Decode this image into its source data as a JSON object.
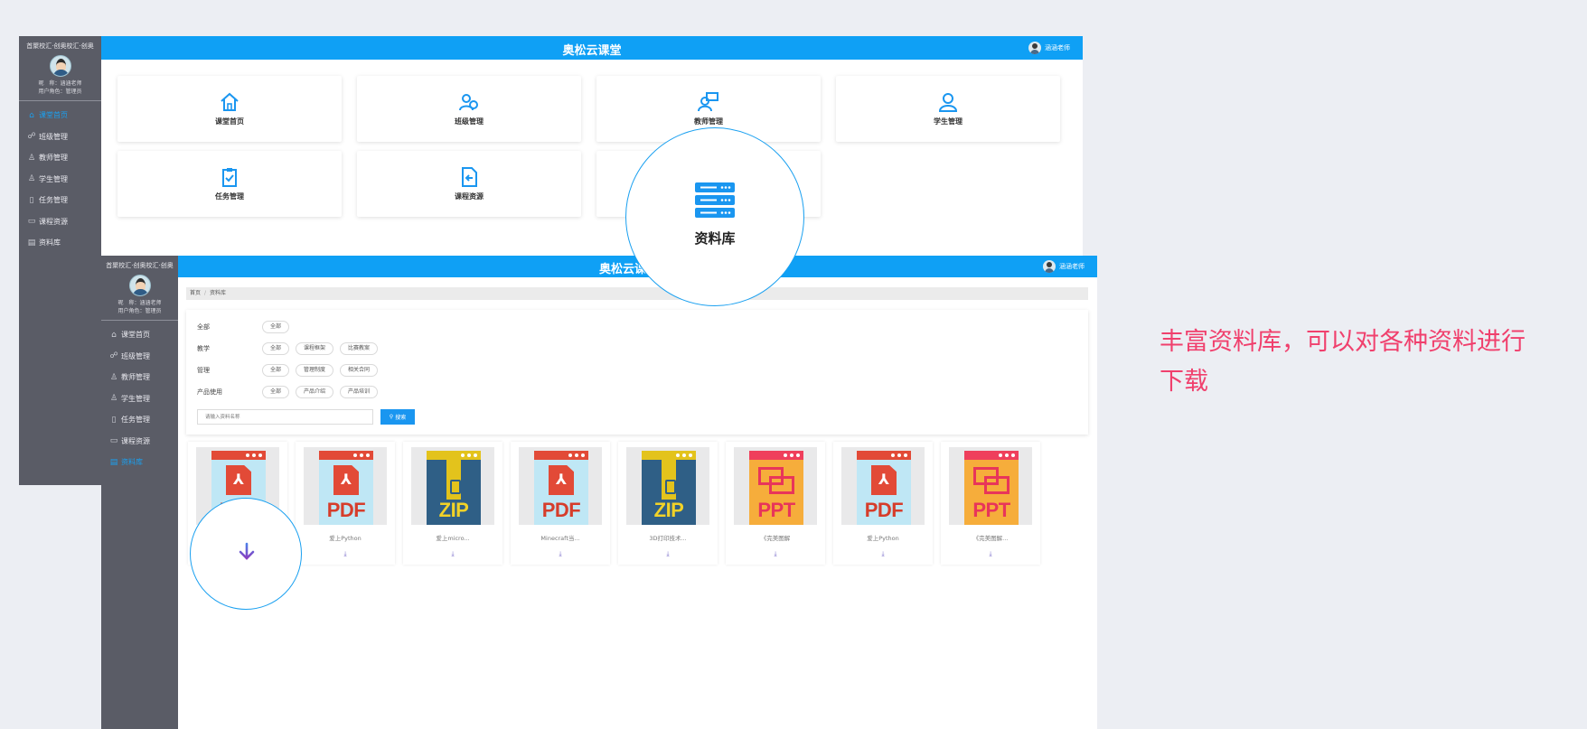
{
  "app_title": "奥松云课堂",
  "user_name": "涵涵老师",
  "sidebar": {
    "school": "首聚校汇·创奥校汇·创奥",
    "nickname": "昵　称：涵涵老师",
    "role": "用户角色：管理员",
    "items": [
      {
        "label": "课堂首页",
        "icon": "home-icon"
      },
      {
        "label": "班级管理",
        "icon": "class-icon"
      },
      {
        "label": "教师管理",
        "icon": "teacher-icon"
      },
      {
        "label": "学生管理",
        "icon": "student-icon"
      },
      {
        "label": "任务管理",
        "icon": "task-icon"
      },
      {
        "label": "课程资源",
        "icon": "course-icon"
      },
      {
        "label": "资料库",
        "icon": "library-icon"
      }
    ]
  },
  "dashboard": {
    "cards": [
      {
        "label": "课堂首页",
        "icon": "home-icon"
      },
      {
        "label": "班级管理",
        "icon": "class-icon"
      },
      {
        "label": "教师管理",
        "icon": "teacher-icon"
      },
      {
        "label": "学生管理",
        "icon": "student-icon"
      },
      {
        "label": "任务管理",
        "icon": "clipboard-icon"
      },
      {
        "label": "课程资源",
        "icon": "resource-icon"
      }
    ]
  },
  "library": {
    "breadcrumb": [
      "首页",
      "资料库"
    ],
    "filters": [
      {
        "label": "全部",
        "chips": [
          "全部"
        ]
      },
      {
        "label": "教学",
        "chips": [
          "全部",
          "课程框架",
          "比赛教案"
        ]
      },
      {
        "label": "管理",
        "chips": [
          "全部",
          "管理制度",
          "相关合同"
        ]
      },
      {
        "label": "产品使用",
        "chips": [
          "全部",
          "产品介绍",
          "产品培训"
        ]
      }
    ],
    "search_placeholder": "请输入资料名称",
    "search_button": "搜索",
    "files": [
      {
        "type": "PDF",
        "name": ""
      },
      {
        "type": "PDF",
        "name": "爱上Python"
      },
      {
        "type": "ZIP",
        "name": "爱上micro..."
      },
      {
        "type": "PDF",
        "name": "Minecraft当..."
      },
      {
        "type": "ZIP",
        "name": "3D打印技术..."
      },
      {
        "type": "PPT",
        "name": "《完美图解"
      },
      {
        "type": "PDF",
        "name": "爱上Python"
      },
      {
        "type": "PPT",
        "name": "《完美图解..."
      }
    ],
    "download_glyph": "⤓"
  },
  "callout": {
    "library_label": "资料库",
    "download_icon": "download-icon"
  },
  "caption": "丰富资料库，可以对各种资料进行下载",
  "colors": {
    "accent": "#0fa0f5",
    "sidebar": "#5a5c66",
    "caption": "#f0406d"
  }
}
